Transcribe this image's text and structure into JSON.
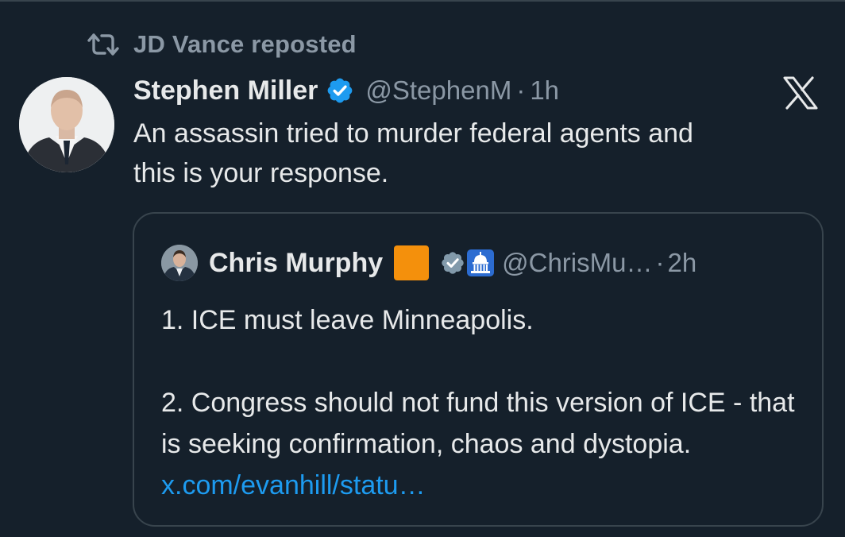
{
  "repost": {
    "icon": "repost-icon",
    "label": "JD Vance reposted"
  },
  "tweet": {
    "author_name": "Stephen Miller",
    "author_verified": true,
    "author_handle": "@StephenM",
    "separator": "·",
    "time": "1h",
    "text": "An assassin tried to murder federal agents and\nthis is your response."
  },
  "branding": {
    "logo": "x-logo-icon"
  },
  "quote": {
    "author_name": "Chris Murphy",
    "author_handle": "@ChrisMu…",
    "separator": "·",
    "time": "2h",
    "badges": [
      "orange-square-icon",
      "gray-verified-icon",
      "capitol-icon"
    ],
    "paragraph_1": "1. ICE must leave Minneapolis.",
    "paragraph_2": "2. Congress should not fund this version of ICE - that is seeking confirmation, chaos and dystopia.",
    "link": "x.com/evanhill/statu…"
  },
  "colors": {
    "background": "#15202b",
    "text_primary": "#e7e9ea",
    "text_secondary": "#8b98a5",
    "link": "#1d9bf0",
    "verified_blue": "#1d9bf0",
    "border": "#38444d"
  }
}
